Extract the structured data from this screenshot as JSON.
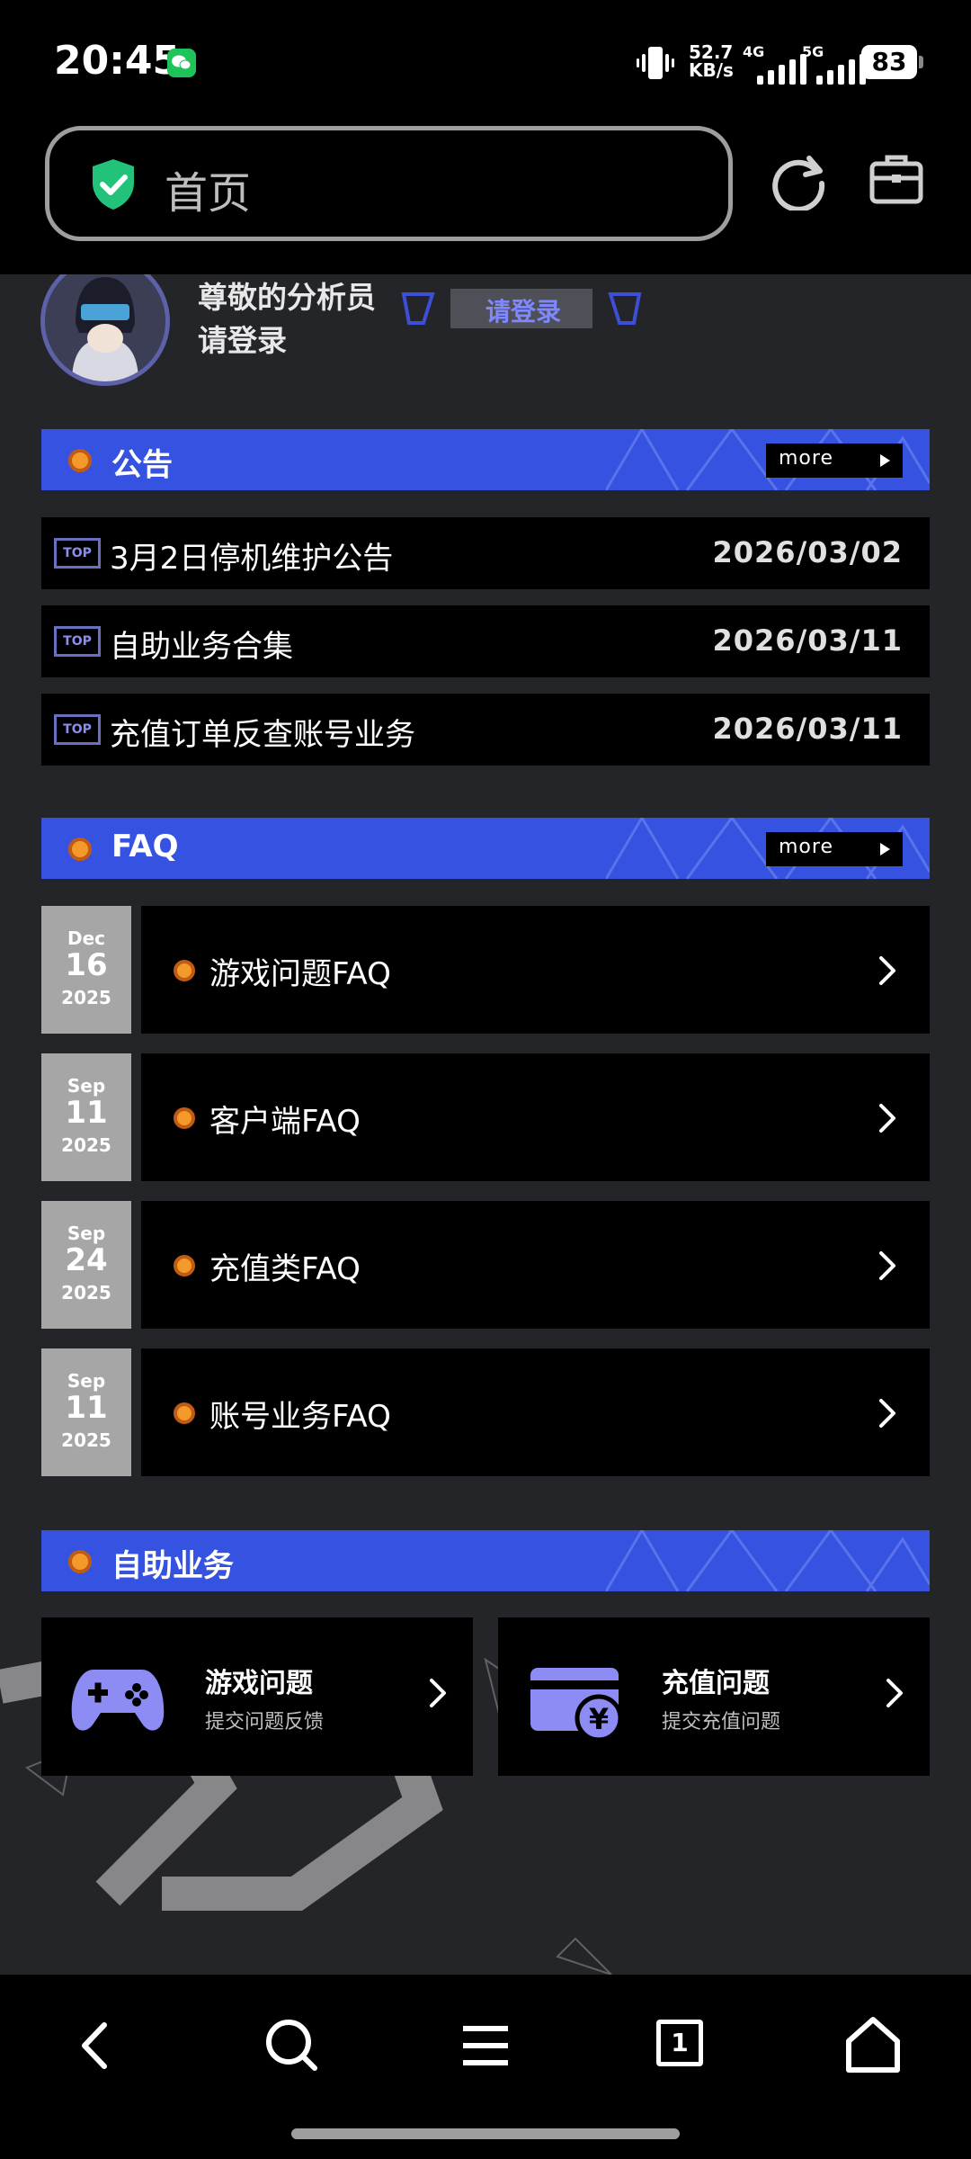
{
  "status_bar": {
    "time": "20:45",
    "net_speed_value": "52.7",
    "net_speed_unit": "KB/s",
    "signal1_label": "4G",
    "signal2_label": "5G",
    "battery": "83",
    "icons": [
      "wechat-icon",
      "vibrate-icon",
      "signal-icon",
      "battery-icon"
    ]
  },
  "address_bar": {
    "url_text": "首页",
    "icons": [
      "shield-check-icon",
      "refresh-icon",
      "briefcase-icon"
    ]
  },
  "user": {
    "greeting_line1": "尊敬的分析员",
    "greeting_line2": "请登录",
    "login_button": "请登录"
  },
  "announcements": {
    "title": "公告",
    "more_label": "more",
    "badge": "TOP",
    "items": [
      {
        "title": "3月2日停机维护公告",
        "date": "2026/03/02"
      },
      {
        "title": "自助业务合集",
        "date": "2026/03/11"
      },
      {
        "title": "充值订单反查账号业务",
        "date": "2026/03/11"
      }
    ]
  },
  "faq": {
    "title": "FAQ",
    "more_label": "more",
    "items": [
      {
        "month": "Dec",
        "day": "16",
        "year": "2025",
        "title": "游戏问题FAQ"
      },
      {
        "month": "Sep",
        "day": "11",
        "year": "2025",
        "title": "客户端FAQ"
      },
      {
        "month": "Sep",
        "day": "24",
        "year": "2025",
        "title": "充值类FAQ"
      },
      {
        "month": "Sep",
        "day": "11",
        "year": "2025",
        "title": "账号业务FAQ"
      }
    ]
  },
  "self_service": {
    "title": "自助业务",
    "items": [
      {
        "title": "游戏问题",
        "subtitle": "提交问题反馈",
        "icon": "gamepad-icon"
      },
      {
        "title": "充值问题",
        "subtitle": "提交充值问题",
        "icon": "recharge-card-icon"
      }
    ]
  },
  "bottom_nav": {
    "tab_count": "1",
    "icons": [
      "back-icon",
      "search-icon",
      "menu-icon",
      "tabs-icon",
      "home-icon"
    ]
  },
  "colors": {
    "accent_blue": "#3552e0",
    "accent_orange": "#f39a2b",
    "page_bg": "#242529",
    "date_block": "#a6a6a6"
  }
}
